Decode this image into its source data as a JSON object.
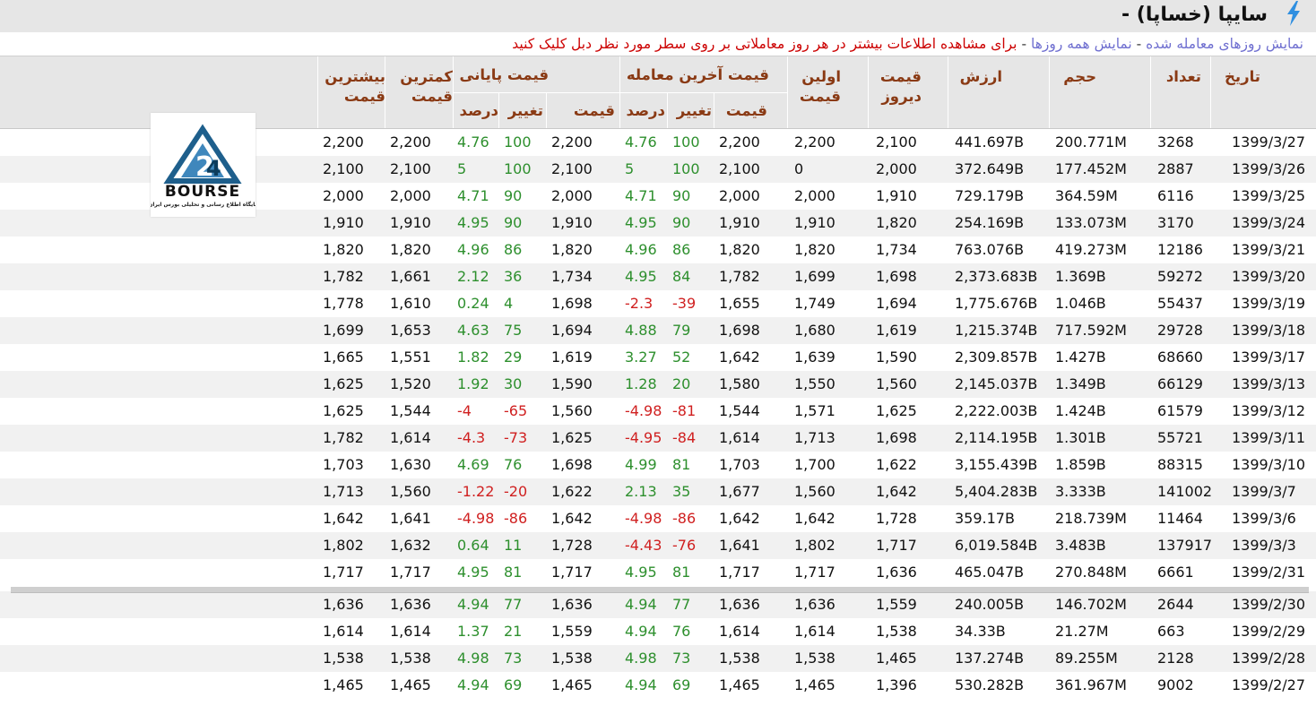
{
  "header": {
    "title": "سایپا (خساپا) -",
    "link_traded_days": "نمایش روزهای معامله شده",
    "link_all_days": "نمایش همه روزها",
    "hint": "برای مشاهده اطلاعات بیشتر در هر روز معاملاتی بر روی سطر مورد نظر دبل کلیک کنید",
    "separator": "-"
  },
  "columns": {
    "date": "تاریخ",
    "count": "تعداد",
    "volume": "حجم",
    "value": "ارزش",
    "prev_price_l1": "قیمت",
    "prev_price_l2": "دیروز",
    "first_price_l1": "اولین",
    "first_price_l2": "قیمت",
    "last_trade_group": "قیمت آخرین معامله",
    "close_group": "قیمت پایانی",
    "min_l1": "کمترین",
    "min_l2": "قیمت",
    "max_l1": "بیشترین",
    "max_l2": "قیمت",
    "sub_price": "قیمت",
    "sub_change": "تغییر",
    "sub_percent": "درصد"
  },
  "logo": {
    "text": "BOURSE",
    "tagline": "پایگاه اطلاع رسانی و تحلیلی بورس ایران",
    "mark": "24"
  },
  "rows": [
    {
      "date": "1399/3/27",
      "count": "3268",
      "volume": "200.771M",
      "value": "441.697B",
      "prev": "2,100",
      "first": "2,200",
      "last": "2,200",
      "last_chg": "100",
      "last_pct": "4.76",
      "close": "2,200",
      "close_chg": "100",
      "close_pct": "4.76",
      "min": "2,200",
      "max": "2,200"
    },
    {
      "date": "1399/3/26",
      "count": "2887",
      "volume": "177.452M",
      "value": "372.649B",
      "prev": "2,000",
      "first": "0",
      "last": "2,100",
      "last_chg": "100",
      "last_pct": "5",
      "close": "2,100",
      "close_chg": "100",
      "close_pct": "5",
      "min": "2,100",
      "max": "2,100"
    },
    {
      "date": "1399/3/25",
      "count": "6116",
      "volume": "364.59M",
      "value": "729.179B",
      "prev": "1,910",
      "first": "2,000",
      "last": "2,000",
      "last_chg": "90",
      "last_pct": "4.71",
      "close": "2,000",
      "close_chg": "90",
      "close_pct": "4.71",
      "min": "2,000",
      "max": "2,000"
    },
    {
      "date": "1399/3/24",
      "count": "3170",
      "volume": "133.073M",
      "value": "254.169B",
      "prev": "1,820",
      "first": "1,910",
      "last": "1,910",
      "last_chg": "90",
      "last_pct": "4.95",
      "close": "1,910",
      "close_chg": "90",
      "close_pct": "4.95",
      "min": "1,910",
      "max": "1,910"
    },
    {
      "date": "1399/3/21",
      "count": "12186",
      "volume": "419.273M",
      "value": "763.076B",
      "prev": "1,734",
      "first": "1,820",
      "last": "1,820",
      "last_chg": "86",
      "last_pct": "4.96",
      "close": "1,820",
      "close_chg": "86",
      "close_pct": "4.96",
      "min": "1,820",
      "max": "1,820"
    },
    {
      "date": "1399/3/20",
      "count": "59272",
      "volume": "1.369B",
      "value": "2,373.683B",
      "prev": "1,698",
      "first": "1,699",
      "last": "1,782",
      "last_chg": "84",
      "last_pct": "4.95",
      "close": "1,734",
      "close_chg": "36",
      "close_pct": "2.12",
      "min": "1,661",
      "max": "1,782"
    },
    {
      "date": "1399/3/19",
      "count": "55437",
      "volume": "1.046B",
      "value": "1,775.676B",
      "prev": "1,694",
      "first": "1,749",
      "last": "1,655",
      "last_chg": "-39",
      "last_pct": "-2.3",
      "close": "1,698",
      "close_chg": "4",
      "close_pct": "0.24",
      "min": "1,610",
      "max": "1,778"
    },
    {
      "date": "1399/3/18",
      "count": "29728",
      "volume": "717.592M",
      "value": "1,215.374B",
      "prev": "1,619",
      "first": "1,680",
      "last": "1,698",
      "last_chg": "79",
      "last_pct": "4.88",
      "close": "1,694",
      "close_chg": "75",
      "close_pct": "4.63",
      "min": "1,653",
      "max": "1,699"
    },
    {
      "date": "1399/3/17",
      "count": "68660",
      "volume": "1.427B",
      "value": "2,309.857B",
      "prev": "1,590",
      "first": "1,639",
      "last": "1,642",
      "last_chg": "52",
      "last_pct": "3.27",
      "close": "1,619",
      "close_chg": "29",
      "close_pct": "1.82",
      "min": "1,551",
      "max": "1,665"
    },
    {
      "date": "1399/3/13",
      "count": "66129",
      "volume": "1.349B",
      "value": "2,145.037B",
      "prev": "1,560",
      "first": "1,550",
      "last": "1,580",
      "last_chg": "20",
      "last_pct": "1.28",
      "close": "1,590",
      "close_chg": "30",
      "close_pct": "1.92",
      "min": "1,520",
      "max": "1,625"
    },
    {
      "date": "1399/3/12",
      "count": "61579",
      "volume": "1.424B",
      "value": "2,222.003B",
      "prev": "1,625",
      "first": "1,571",
      "last": "1,544",
      "last_chg": "-81",
      "last_pct": "-4.98",
      "close": "1,560",
      "close_chg": "-65",
      "close_pct": "-4",
      "min": "1,544",
      "max": "1,625"
    },
    {
      "date": "1399/3/11",
      "count": "55721",
      "volume": "1.301B",
      "value": "2,114.195B",
      "prev": "1,698",
      "first": "1,713",
      "last": "1,614",
      "last_chg": "-84",
      "last_pct": "-4.95",
      "close": "1,625",
      "close_chg": "-73",
      "close_pct": "-4.3",
      "min": "1,614",
      "max": "1,782"
    },
    {
      "date": "1399/3/10",
      "count": "88315",
      "volume": "1.859B",
      "value": "3,155.439B",
      "prev": "1,622",
      "first": "1,700",
      "last": "1,703",
      "last_chg": "81",
      "last_pct": "4.99",
      "close": "1,698",
      "close_chg": "76",
      "close_pct": "4.69",
      "min": "1,630",
      "max": "1,703"
    },
    {
      "date": "1399/3/7",
      "count": "141002",
      "volume": "3.333B",
      "value": "5,404.283B",
      "prev": "1,642",
      "first": "1,560",
      "last": "1,677",
      "last_chg": "35",
      "last_pct": "2.13",
      "close": "1,622",
      "close_chg": "-20",
      "close_pct": "-1.22",
      "min": "1,560",
      "max": "1,713"
    },
    {
      "date": "1399/3/6",
      "count": "11464",
      "volume": "218.739M",
      "value": "359.17B",
      "prev": "1,728",
      "first": "1,642",
      "last": "1,642",
      "last_chg": "-86",
      "last_pct": "-4.98",
      "close": "1,642",
      "close_chg": "-86",
      "close_pct": "-4.98",
      "min": "1,641",
      "max": "1,642"
    },
    {
      "date": "1399/3/3",
      "count": "137917",
      "volume": "3.483B",
      "value": "6,019.584B",
      "prev": "1,717",
      "first": "1,802",
      "last": "1,641",
      "last_chg": "-76",
      "last_pct": "-4.43",
      "close": "1,728",
      "close_chg": "11",
      "close_pct": "0.64",
      "min": "1,632",
      "max": "1,802"
    },
    {
      "date": "1399/2/31",
      "count": "6661",
      "volume": "270.848M",
      "value": "465.047B",
      "prev": "1,636",
      "first": "1,717",
      "last": "1,717",
      "last_chg": "81",
      "last_pct": "4.95",
      "close": "1,717",
      "close_chg": "81",
      "close_pct": "4.95",
      "min": "1,717",
      "max": "1,717"
    },
    {
      "date": "1399/2/30",
      "count": "2644",
      "volume": "146.702M",
      "value": "240.005B",
      "prev": "1,559",
      "first": "1,636",
      "last": "1,636",
      "last_chg": "77",
      "last_pct": "4.94",
      "close": "1,636",
      "close_chg": "77",
      "close_pct": "4.94",
      "min": "1,636",
      "max": "1,636"
    },
    {
      "date": "1399/2/29",
      "count": "663",
      "volume": "21.27M",
      "value": "34.33B",
      "prev": "1,538",
      "first": "1,614",
      "last": "1,614",
      "last_chg": "76",
      "last_pct": "4.94",
      "close": "1,559",
      "close_chg": "21",
      "close_pct": "1.37",
      "min": "1,614",
      "max": "1,614"
    },
    {
      "date": "1399/2/28",
      "count": "2128",
      "volume": "89.255M",
      "value": "137.274B",
      "prev": "1,465",
      "first": "1,538",
      "last": "1,538",
      "last_chg": "73",
      "last_pct": "4.98",
      "close": "1,538",
      "close_chg": "73",
      "close_pct": "4.98",
      "min": "1,538",
      "max": "1,538"
    },
    {
      "date": "1399/2/27",
      "count": "9002",
      "volume": "361.967M",
      "value": "530.282B",
      "prev": "1,396",
      "first": "1,465",
      "last": "1,465",
      "last_chg": "69",
      "last_pct": "4.94",
      "close": "1,465",
      "close_chg": "69",
      "close_pct": "4.94",
      "min": "1,465",
      "max": "1,465"
    }
  ]
}
